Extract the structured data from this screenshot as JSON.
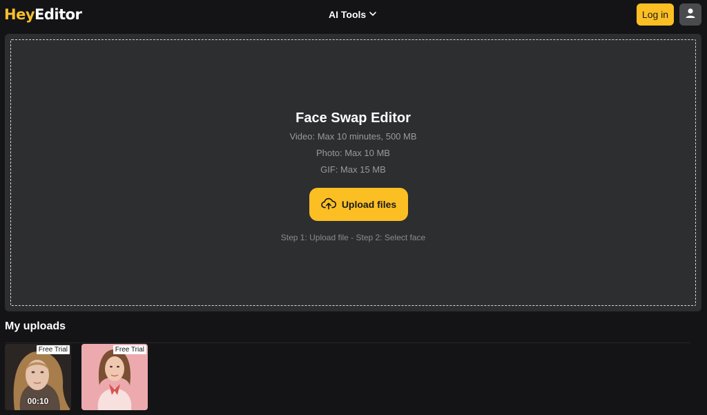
{
  "header": {
    "logo_part1": "Hey",
    "logo_part2": "Editor",
    "ai_tools_label": "AI Tools",
    "login_label": "Log in"
  },
  "upload_panel": {
    "title": "Face Swap Editor",
    "limits": [
      "Video: Max 10 minutes, 500 MB",
      "Photo: Max 10 MB",
      "GIF: Max 15 MB"
    ],
    "upload_button_label": "Upload files",
    "steps_text": "Step 1: Upload file - Step 2: Select face"
  },
  "uploads": {
    "title": "My uploads",
    "items": [
      {
        "badge": "Free Trial",
        "duration": "00:10",
        "kind": "video"
      },
      {
        "badge": "Free Trial",
        "duration": "",
        "kind": "photo"
      }
    ]
  },
  "colors": {
    "accent": "#fbbf24",
    "background": "#141416",
    "panel": "#2d2e30"
  },
  "icons": {
    "ai_tools_chevron": "chevron-down-icon",
    "avatar": "user-icon",
    "upload": "cloud-upload-icon"
  }
}
